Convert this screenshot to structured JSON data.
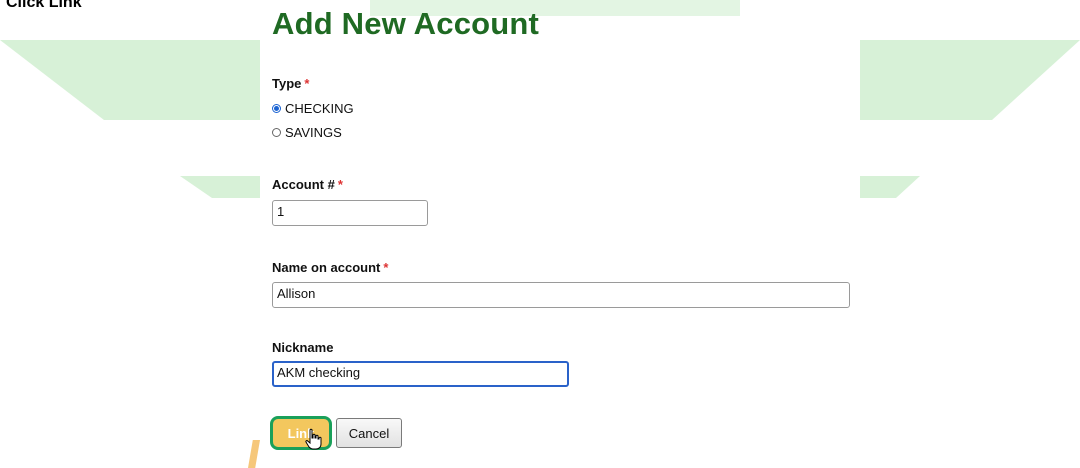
{
  "instruction": {
    "prefix": "Click",
    "target": "Link"
  },
  "form": {
    "title": "Add New Account",
    "type": {
      "label": "Type",
      "required_mark": "*",
      "options": [
        "CHECKING",
        "SAVINGS"
      ],
      "selected": "CHECKING"
    },
    "account_number": {
      "label": "Account #",
      "required_mark": "*",
      "value": "1"
    },
    "name_on_account": {
      "label": "Name on account",
      "required_mark": "*",
      "value": "Allison"
    },
    "nickname": {
      "label": "Nickname",
      "value": "AKM checking"
    },
    "buttons": {
      "link_label": "Link",
      "cancel_label": "Cancel"
    }
  },
  "colors": {
    "title_green": "#1f6a23",
    "background_band": "#d7f1d7",
    "link_button": "#f3c75e",
    "highlight_outline": "#1aa05a",
    "focus_border": "#2a62c9",
    "required_mark": "#d33"
  },
  "icons": {
    "cursor": "hand-pointer-icon"
  }
}
